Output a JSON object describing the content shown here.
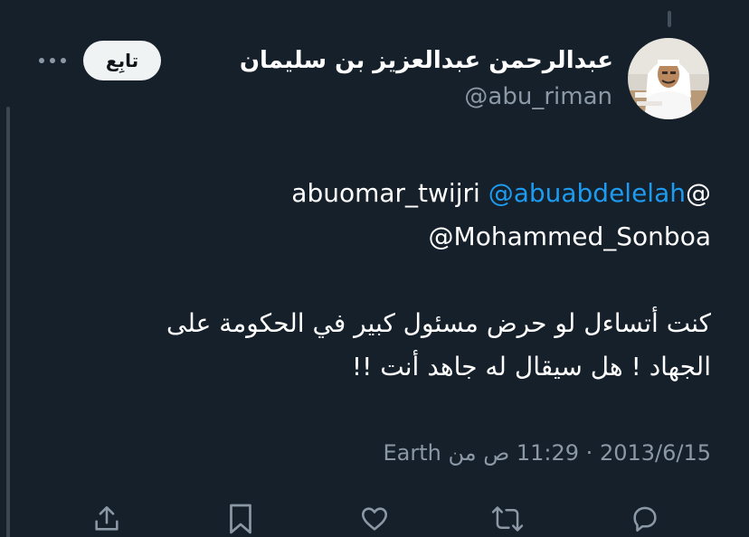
{
  "author": {
    "display_name": "عبدالرحمن عبدالعزيز بن سليمان",
    "handle": "@abu_riman",
    "avatar_icon": "profile-photo"
  },
  "follow_label": "تابِع",
  "more_icon": "more-dots-icon",
  "tweet": {
    "line1_prefix": "abuomar_twijri ",
    "line1_mention": "@abuabdelelah",
    "line1_suffix": "@",
    "line2": "@Mohammed_Sonboa",
    "line3": "كنت أتساءل لو حرض مسئول كبير في الحكومة على",
    "line4": "الجهاد ! هل سيقال له جاهد أنت !!"
  },
  "meta": {
    "text": "2013/6/15 · 11:29 ص من Earth"
  },
  "actions": {
    "reply_icon": "reply-icon",
    "retweet_icon": "retweet-icon",
    "like_icon": "heart-icon",
    "bookmark_icon": "bookmark-icon",
    "share_icon": "share-icon"
  },
  "colors": {
    "background": "#15202b",
    "text": "#ffffff",
    "secondary": "#8b98a5",
    "link": "#1d9bf0",
    "button_bg": "#eff3f4"
  }
}
